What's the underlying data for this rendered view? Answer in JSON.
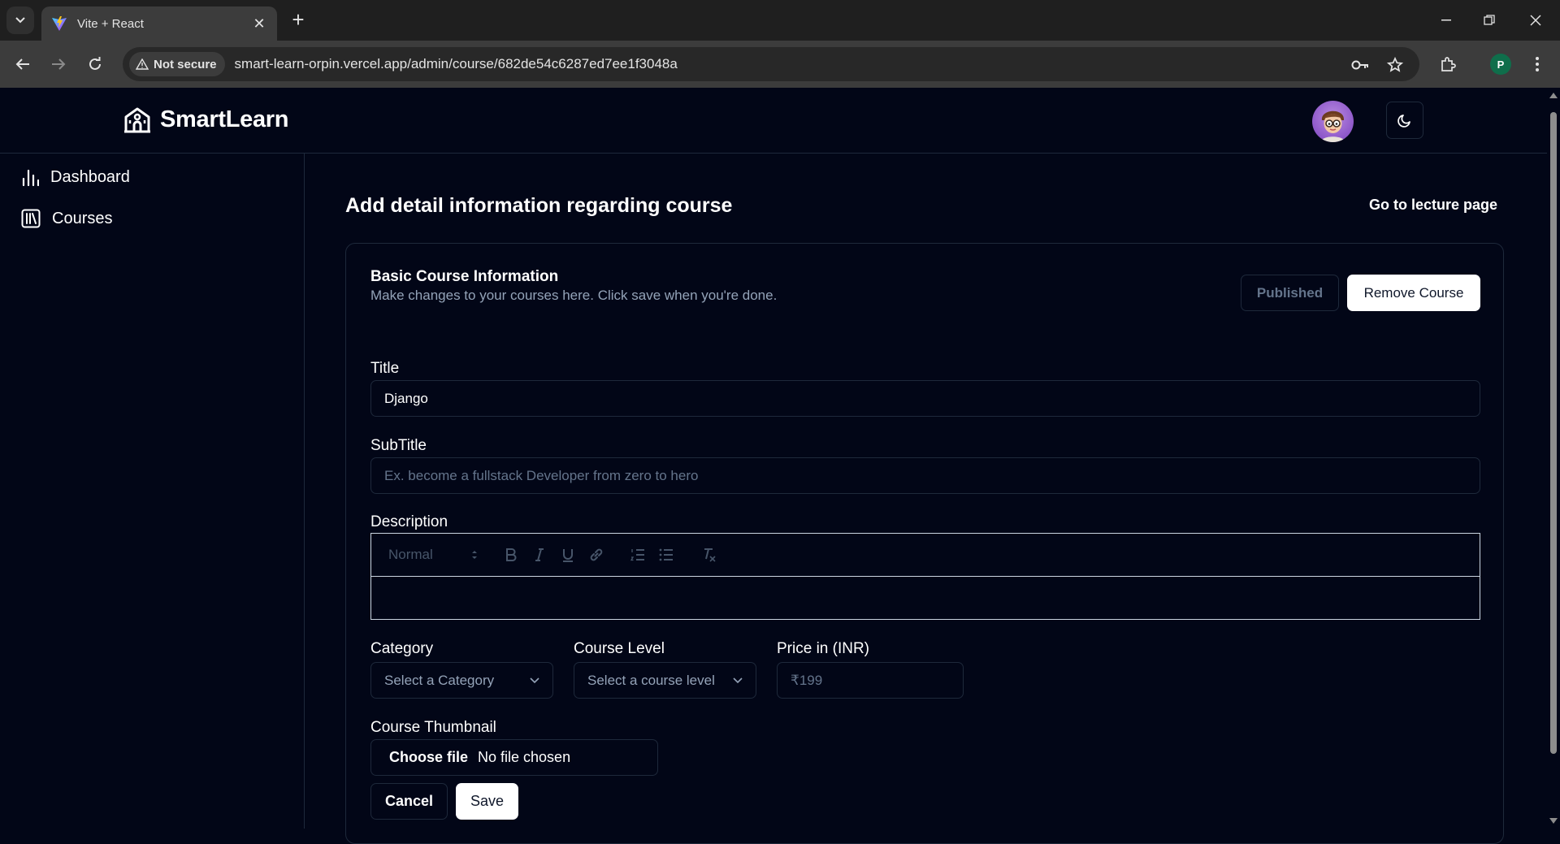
{
  "browser": {
    "tab_title": "Vite + React",
    "security_label": "Not secure",
    "url": "smart-learn-orpin.vercel.app/admin/course/682de54c6287ed7ee1f3048a",
    "profile_initial": "P"
  },
  "header": {
    "brand": "SmartLearn"
  },
  "sidebar": {
    "items": [
      {
        "label": "Dashboard",
        "icon": "bar-chart-icon"
      },
      {
        "label": "Courses",
        "icon": "library-icon"
      }
    ]
  },
  "page": {
    "title": "Add detail information regarding course",
    "lecture_link": "Go to lecture page"
  },
  "card": {
    "title": "Basic Course Information",
    "description": "Make changes to your courses here. Click save when you're done.",
    "published_label": "Published",
    "remove_label": "Remove Course"
  },
  "form": {
    "title_label": "Title",
    "title_value": "Django",
    "subtitle_label": "SubTitle",
    "subtitle_placeholder": "Ex. become a fullstack Developer from zero to hero",
    "description_label": "Description",
    "editor_format": "Normal",
    "category_label": "Category",
    "category_placeholder": "Select a Category",
    "level_label": "Course Level",
    "level_placeholder": "Select a course level",
    "price_label": "Price in (INR)",
    "price_placeholder": "₹199",
    "thumbnail_label": "Course Thumbnail",
    "file_button": "Choose file",
    "file_status": "No file chosen",
    "cancel_label": "Cancel",
    "save_label": "Save"
  },
  "colors": {
    "background": "#020617",
    "border": "#1e293b",
    "muted_text": "#94a3b8"
  }
}
